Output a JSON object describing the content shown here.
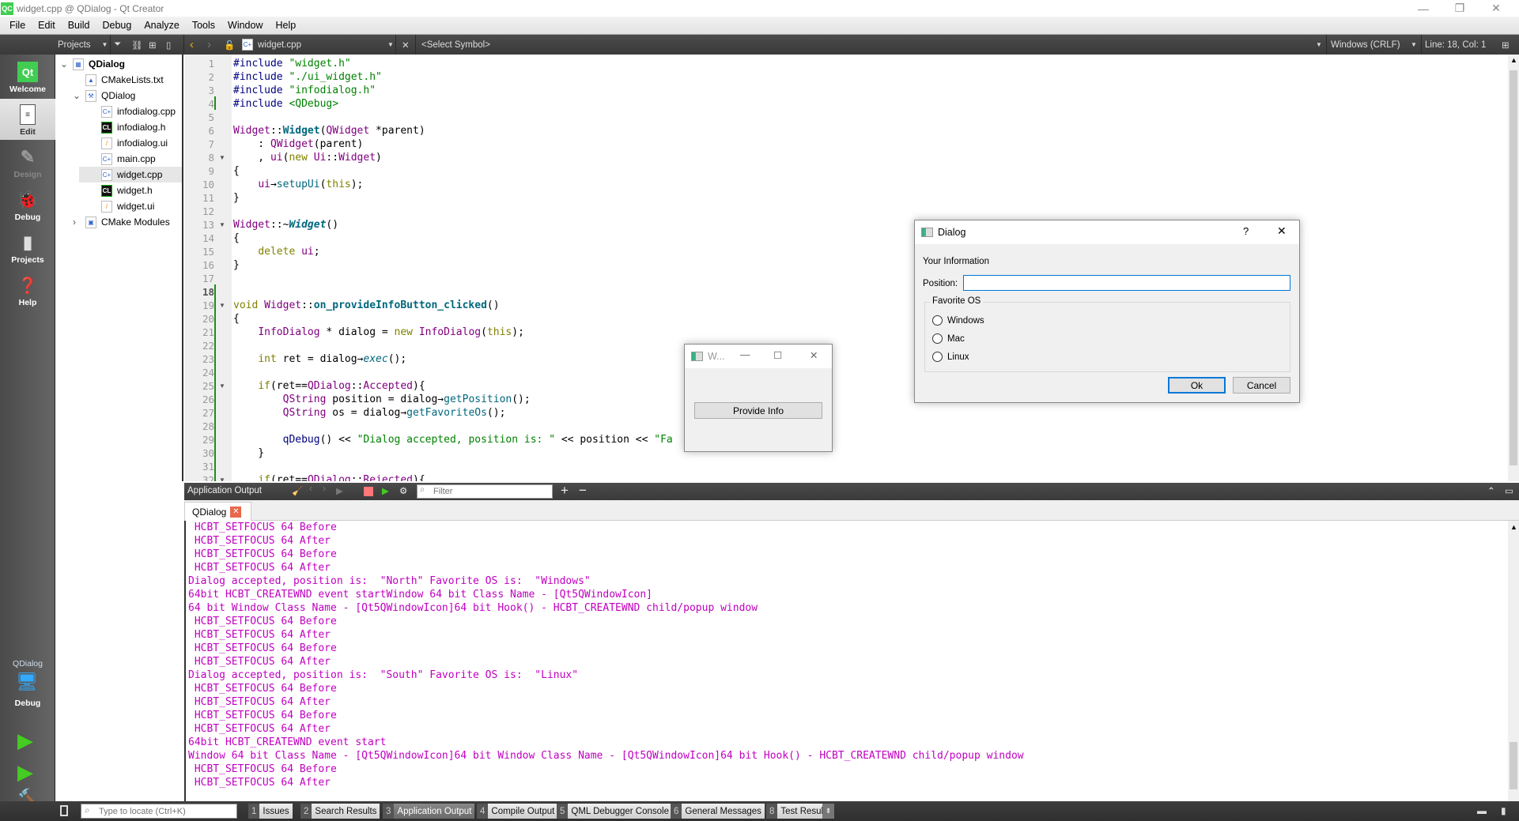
{
  "window": {
    "title": "widget.cpp @ QDialog - Qt Creator",
    "logo": "QC"
  },
  "menu": [
    "File",
    "Edit",
    "Build",
    "Debug",
    "Analyze",
    "Tools",
    "Window",
    "Help"
  ],
  "toolbar": {
    "projects_label": "Projects",
    "file_name": "widget.cpp",
    "symbol": "<Select Symbol>",
    "line_ending": "Windows (CRLF)",
    "position": "Line: 18, Col: 1"
  },
  "modes": [
    {
      "label": "Welcome",
      "icon": "qt-logo-icon"
    },
    {
      "label": "Edit",
      "icon": "edit-document-icon",
      "selected": true
    },
    {
      "label": "Design",
      "icon": "design-pencil-icon",
      "disabled": true
    },
    {
      "label": "Debug",
      "icon": "bug-icon"
    },
    {
      "label": "Projects",
      "icon": "projects-icon"
    },
    {
      "label": "Help",
      "icon": "help-icon"
    }
  ],
  "kit": {
    "project": "QDialog",
    "build": "Debug"
  },
  "tree": [
    {
      "label": "QDialog",
      "level": 0,
      "expanded": true,
      "icon": "project-icon",
      "bold": true
    },
    {
      "label": "CMakeLists.txt",
      "level": 1,
      "icon": "cmake-file-icon"
    },
    {
      "label": "QDialog",
      "level": 1,
      "expanded": true,
      "icon": "build-target-icon"
    },
    {
      "label": "infodialog.cpp",
      "level": 2,
      "icon": "cpp-file-icon"
    },
    {
      "label": "infodialog.h",
      "level": 2,
      "icon": "header-file-icon"
    },
    {
      "label": "infodialog.ui",
      "level": 2,
      "icon": "ui-file-icon"
    },
    {
      "label": "main.cpp",
      "level": 2,
      "icon": "cpp-file-icon"
    },
    {
      "label": "widget.cpp",
      "level": 2,
      "icon": "cpp-file-icon",
      "selected": true
    },
    {
      "label": "widget.h",
      "level": 2,
      "icon": "header-file-icon"
    },
    {
      "label": "widget.ui",
      "level": 2,
      "icon": "ui-file-icon"
    },
    {
      "label": "CMake Modules",
      "level": 1,
      "expanded": false,
      "icon": "modules-icon"
    }
  ],
  "code": {
    "current_line": 18,
    "fold_lines": [
      8,
      13,
      19,
      25,
      32
    ],
    "lines": [
      [
        [
          "k",
          "#include "
        ],
        [
          "s",
          "\"widget.h\""
        ]
      ],
      [
        [
          "k",
          "#include "
        ],
        [
          "s",
          "\"./ui_widget.h\""
        ]
      ],
      [
        [
          "k",
          "#include "
        ],
        [
          "s",
          "\"infodialog.h\""
        ]
      ],
      [
        [
          "k",
          "#include "
        ],
        [
          "s",
          "<QDebug>"
        ]
      ],
      [],
      [
        [
          "c",
          "Widget"
        ],
        [
          "",
          "::"
        ],
        [
          "f b",
          "Widget"
        ],
        [
          "",
          "("
        ],
        [
          "c",
          "QWidget"
        ],
        [
          "",
          " *parent)"
        ]
      ],
      [
        [
          "",
          "    : "
        ],
        [
          "c",
          "QWidget"
        ],
        [
          "",
          "(parent)"
        ]
      ],
      [
        [
          "",
          "    , "
        ],
        [
          "c",
          "ui"
        ],
        [
          "",
          "("
        ],
        [
          "kw",
          "new "
        ],
        [
          "c",
          "Ui"
        ],
        [
          "",
          "::"
        ],
        [
          "c",
          "Widget"
        ],
        [
          "",
          ")"
        ]
      ],
      [
        [
          "",
          "{"
        ]
      ],
      [
        [
          "",
          "    "
        ],
        [
          "c",
          "ui"
        ],
        [
          "",
          "→"
        ],
        [
          "f",
          "setupUi"
        ],
        [
          "",
          "("
        ],
        [
          "kw",
          "this"
        ],
        [
          "",
          ");"
        ]
      ],
      [
        [
          "",
          "}"
        ]
      ],
      [],
      [
        [
          "c",
          "Widget"
        ],
        [
          "",
          "::~"
        ],
        [
          "f b i",
          "Widget"
        ],
        [
          "",
          "()"
        ]
      ],
      [
        [
          "",
          "{"
        ]
      ],
      [
        [
          "",
          "    "
        ],
        [
          "kw",
          "delete "
        ],
        [
          "c",
          "ui"
        ],
        [
          "",
          ";"
        ]
      ],
      [
        [
          "",
          "}"
        ]
      ],
      [],
      [],
      [
        [
          "kw",
          "void "
        ],
        [
          "c",
          "Widget"
        ],
        [
          "",
          "::"
        ],
        [
          "f b",
          "on_provideInfoButton_clicked"
        ],
        [
          "",
          "()"
        ]
      ],
      [
        [
          "",
          "{"
        ]
      ],
      [
        [
          "",
          "    "
        ],
        [
          "c",
          "InfoDialog"
        ],
        [
          "",
          " * dialog = "
        ],
        [
          "kw",
          "new "
        ],
        [
          "c",
          "InfoDialog"
        ],
        [
          "",
          "("
        ],
        [
          "kw",
          "this"
        ],
        [
          "",
          ");"
        ]
      ],
      [],
      [
        [
          "",
          "    "
        ],
        [
          "kw",
          "int"
        ],
        [
          "",
          " ret = dialog→"
        ],
        [
          "f i",
          "exec"
        ],
        [
          "",
          "();"
        ]
      ],
      [],
      [
        [
          "",
          "    "
        ],
        [
          "kw",
          "if"
        ],
        [
          "",
          "(ret=="
        ],
        [
          "c",
          "QDialog"
        ],
        [
          "",
          "::"
        ],
        [
          "c",
          "Accepted"
        ],
        [
          "",
          "){"
        ]
      ],
      [
        [
          "",
          "        "
        ],
        [
          "c",
          "QString"
        ],
        [
          "",
          " position = dialog→"
        ],
        [
          "f",
          "getPosition"
        ],
        [
          "",
          "();"
        ]
      ],
      [
        [
          "",
          "        "
        ],
        [
          "c",
          "QString"
        ],
        [
          "",
          " os = dialog→"
        ],
        [
          "f",
          "getFavoriteOs"
        ],
        [
          "",
          "();"
        ]
      ],
      [],
      [
        [
          "",
          "        "
        ],
        [
          "k",
          "qDebug"
        ],
        [
          "",
          "() << "
        ],
        [
          "s",
          "\"Dialog accepted, position is: \""
        ],
        [
          "",
          " << position << "
        ],
        [
          "s",
          "\"Fa"
        ]
      ],
      [
        [
          "",
          "    }"
        ]
      ],
      [],
      [
        [
          "",
          "    "
        ],
        [
          "kw",
          "if"
        ],
        [
          "",
          "(ret=="
        ],
        [
          "c",
          "QDialog"
        ],
        [
          "",
          "::"
        ],
        [
          "c",
          "Rejected"
        ],
        [
          "",
          "){"
        ]
      ]
    ]
  },
  "output_panel": {
    "title": "Application Output",
    "filter_placeholder": "Filter",
    "tab": "QDialog",
    "lines": [
      " HCBT_SETFOCUS 64 Before",
      " HCBT_SETFOCUS 64 After",
      " HCBT_SETFOCUS 64 Before",
      " HCBT_SETFOCUS 64 After",
      "Dialog accepted, position is:  \"North\" Favorite OS is:  \"Windows\"",
      "64bit HCBT_CREATEWND event startWindow 64 bit Class Name - [Qt5QWindowIcon]",
      "64 bit Window Class Name - [Qt5QWindowIcon]64 bit Hook() - HCBT_CREATEWND child/popup window",
      " HCBT_SETFOCUS 64 Before",
      " HCBT_SETFOCUS 64 After",
      " HCBT_SETFOCUS 64 Before",
      " HCBT_SETFOCUS 64 After",
      "Dialog accepted, position is:  \"South\" Favorite OS is:  \"Linux\"",
      " HCBT_SETFOCUS 64 Before",
      " HCBT_SETFOCUS 64 After",
      " HCBT_SETFOCUS 64 Before",
      " HCBT_SETFOCUS 64 After",
      "64bit HCBT_CREATEWND event start",
      "Window 64 bit Class Name - [Qt5QWindowIcon]64 bit Window Class Name - [Qt5QWindowIcon]64 bit Hook() - HCBT_CREATEWND child/popup window",
      " HCBT_SETFOCUS 64 Before",
      " HCBT_SETFOCUS 64 After"
    ]
  },
  "statusbar": {
    "locator_placeholder": "Type to locate (Ctrl+K)",
    "panes": [
      {
        "n": "1",
        "label": "Issues"
      },
      {
        "n": "2",
        "label": "Search Results"
      },
      {
        "n": "3",
        "label": "Application Output",
        "active": true
      },
      {
        "n": "4",
        "label": "Compile Output"
      },
      {
        "n": "5",
        "label": "QML Debugger Console"
      },
      {
        "n": "6",
        "label": "General Messages"
      },
      {
        "n": "8",
        "label": "Test Results"
      }
    ]
  },
  "widget_window": {
    "title": "W...",
    "button": "Provide Info"
  },
  "dialog": {
    "title": "Dialog",
    "help": "?",
    "section": "Your Information",
    "position_label": "Position:",
    "position_value": "",
    "group": "Favorite OS",
    "options": [
      "Windows",
      "Mac",
      "Linux"
    ],
    "ok": "Ok",
    "cancel": "Cancel",
    "accent": "#0078d7"
  },
  "colors": {
    "output_text": "#c000c0",
    "keyword": "#000080",
    "string": "#008000",
    "type": "#800080",
    "function": "#00677c"
  }
}
